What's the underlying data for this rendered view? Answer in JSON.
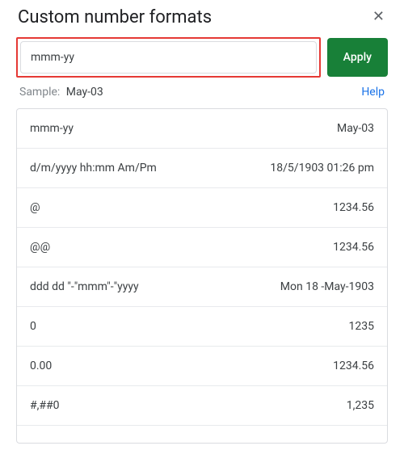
{
  "dialog": {
    "title": "Custom number formats",
    "close_symbol": "✕"
  },
  "input": {
    "value": "mmm-yy",
    "apply_label": "Apply"
  },
  "sample": {
    "label": "Sample:",
    "value": "May-03",
    "help_label": "Help"
  },
  "formats": [
    {
      "pattern": "mmm-yy",
      "preview": "May-03"
    },
    {
      "pattern": "d/m/yyyy hh:mm Am/Pm",
      "preview": "18/5/1903 01:26 pm"
    },
    {
      "pattern": "@",
      "preview": "1234.56"
    },
    {
      "pattern": "@@",
      "preview": "1234.56"
    },
    {
      "pattern": "ddd dd \"-\"mmm\"-\"yyyy",
      "preview": "Mon 18 -May-1903"
    },
    {
      "pattern": "0",
      "preview": "1235"
    },
    {
      "pattern": "0.00",
      "preview": "1234.56"
    },
    {
      "pattern": "#,##0",
      "preview": "1,235"
    }
  ]
}
